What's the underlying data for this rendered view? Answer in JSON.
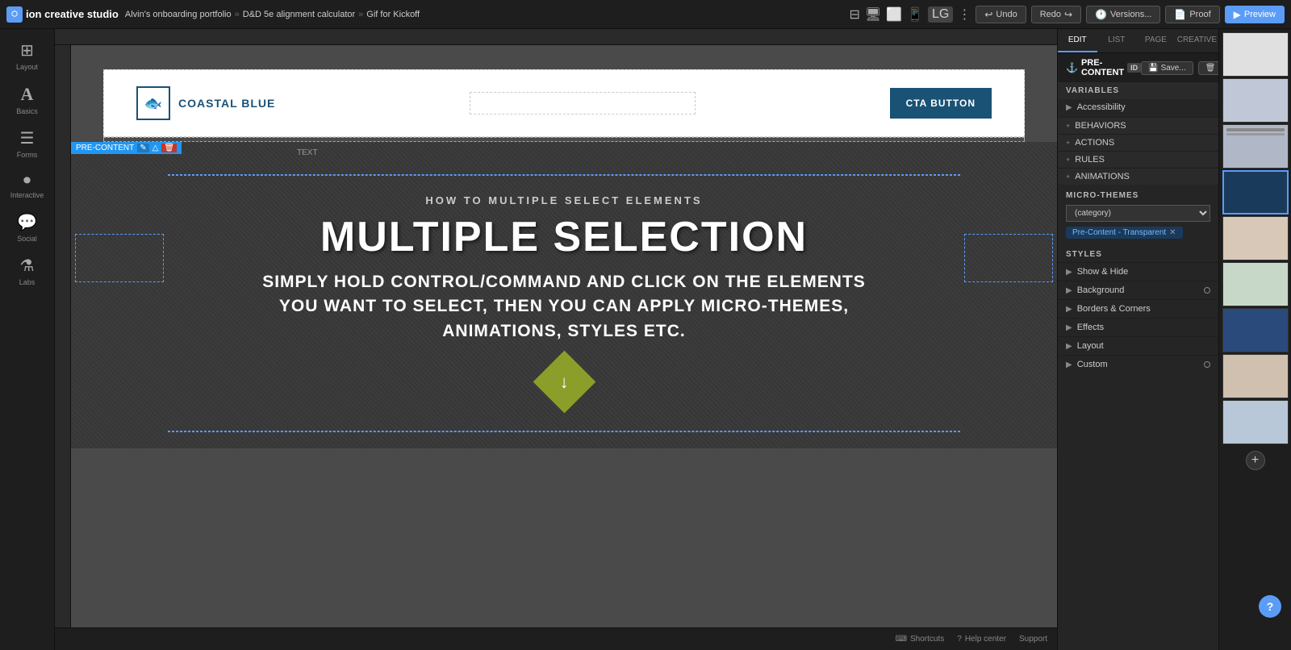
{
  "app": {
    "name": "ion creative studio",
    "ion_label": "ion"
  },
  "breadcrumb": {
    "items": [
      "Alvin's onboarding portfolio",
      "D&D 5e alignment calculator",
      "Gif for Kickoff"
    ]
  },
  "top_bar": {
    "undo": "Undo",
    "redo": "Redo",
    "versions": "Versions...",
    "proof": "Proof",
    "preview": "Preview",
    "lg_label": "LG"
  },
  "left_sidebar": {
    "items": [
      {
        "label": "Layout",
        "icon": "⊞"
      },
      {
        "label": "Basics",
        "icon": "A"
      },
      {
        "label": "Forms",
        "icon": "☰"
      },
      {
        "label": "Interactive",
        "icon": "⏺"
      },
      {
        "label": "Social",
        "icon": "💬"
      },
      {
        "label": "Labs",
        "icon": "⚗"
      }
    ]
  },
  "canvas": {
    "pre_content_label": "PRE-CONTENT",
    "text_label": "TEXT",
    "header": {
      "brand_name": "COASTAL\nBLUE",
      "cta_button": "CTA BUTTON"
    },
    "dark_section": {
      "how_to": "HOW TO MULTIPLE SELECT ELEMENTS",
      "heading": "MULTIPLE SELECTION",
      "body": "SIMPLY HOLD CONTROL/COMMAND AND CLICK ON THE ELEMENTS YOU WANT TO SELECT, THEN YOU CAN APPLY MICRO-THEMES, ANIMATIONS, STYLES ETC."
    }
  },
  "right_panel": {
    "tabs": [
      "EDIT",
      "LIST",
      "PAGE",
      "CREATIVE"
    ],
    "active_tab": "EDIT",
    "section_title": "PRE-CONTENT",
    "save_label": "Save...",
    "remove_label": "Remove",
    "sections": {
      "variables": "VARIABLES",
      "accessibility": "Accessibility",
      "behaviors": "BEHAVIORS",
      "actions": "ACTIONS",
      "rules": "RULES",
      "animations": "ANIMATIONS"
    },
    "micro_themes": {
      "title": "MICRO-THEMES",
      "category_placeholder": "(category)",
      "tag": "Pre-Content - Transparent"
    },
    "styles": {
      "title": "STYLES",
      "items": [
        {
          "label": "Show & Hide",
          "has_dot": false
        },
        {
          "label": "Background",
          "has_dot": true
        },
        {
          "label": "Borders & Corners",
          "has_dot": false
        },
        {
          "label": "Effects",
          "has_dot": false
        },
        {
          "label": "Layout",
          "has_dot": false
        },
        {
          "label": "Custom",
          "has_dot": true
        }
      ]
    }
  },
  "bottom_bar": {
    "shortcuts": "Shortcuts",
    "help_center": "Help center",
    "support": "Support"
  },
  "help_button": "?",
  "add_button": "+"
}
